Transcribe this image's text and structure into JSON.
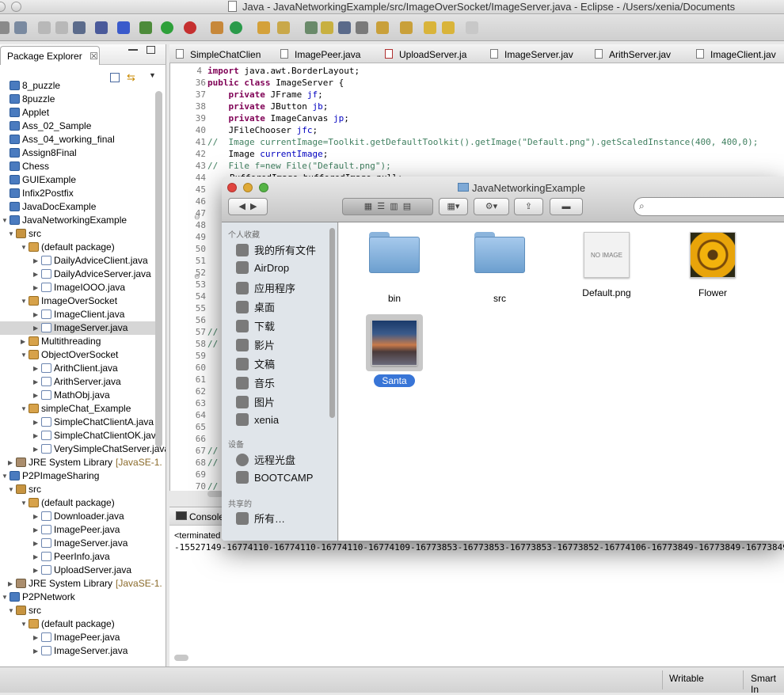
{
  "window": {
    "title": "Java - JavaNetworkingExample/src/ImageOverSocket/ImageServer.java - Eclipse - /Users/xenia/Documents"
  },
  "package_explorer": {
    "tab_label": "Package Explorer",
    "rows": [
      "8_puzzle",
      "8puzzle",
      "Applet",
      "Ass_02_Sample",
      "Ass_04_working_final",
      "Assign8Final",
      "Chess",
      "GUIExample",
      "Infix2Postfix",
      "JavaDocExample",
      "JavaNetworkingExample",
      "src",
      "(default package)",
      "DailyAdviceClient.java",
      "DailyAdviceServer.java",
      "ImageIOOO.java",
      "ImageOverSocket",
      "ImageClient.java",
      "ImageServer.java",
      "Multithreading",
      "ObjectOverSocket",
      "ArithClient.java",
      "ArithServer.java",
      "MathObj.java",
      "simpleChat_Example",
      "SimpleChatClientA.java",
      "SimpleChatClientOK.java",
      "VerySimpleChatServer.java",
      "JRE System Library",
      "P2PImageSharing",
      "src",
      "(default package)",
      "Downloader.java",
      "ImagePeer.java",
      "ImageServer.java",
      "PeerInfo.java",
      "UploadServer.java",
      "JRE System Library",
      "P2PNetwork",
      "src",
      "(default package)",
      "ImagePeer.java",
      "ImageServer.java"
    ],
    "jre_suffix": "[JavaSE-1."
  },
  "editor": {
    "tabs": [
      "SimpleChatClien",
      "ImagePeer.java",
      "UploadServer.ja",
      "ImageServer.jav",
      "ArithServer.jav",
      "ImageClient.jav"
    ],
    "line_numbers": [
      "4",
      "36",
      "37",
      "38",
      "39",
      "40",
      "41",
      "42",
      "43",
      "44",
      "45",
      "46",
      "47",
      "48",
      "49",
      "50",
      "51",
      "52",
      "53",
      "54",
      "55",
      "56",
      "57",
      "58",
      "59",
      "60",
      "61",
      "62",
      "63",
      "64",
      "65",
      "66",
      "67",
      "68",
      "69",
      "70"
    ],
    "code": {
      "l4": "import java.awt.BorderLayout;",
      "l36_kw": "public class",
      "l36_rest": " ImageServer {",
      "l37_kw": "private",
      "l37_type": " JFrame ",
      "l37_f": "jf",
      "l37_e": ";",
      "l38_kw": "private",
      "l38_type": " JButton ",
      "l38_f": "jb",
      "l38_e": ";",
      "l39_kw": "private",
      "l39_type": " ImageCanvas ",
      "l39_f": "jp",
      "l39_e": ";",
      "l40_type": "JFileChooser ",
      "l40_f": "jfc",
      "l40_e": ";",
      "l41": "//  Image currentImage=Toolkit.getDefaultToolkit().getImage(\"Default.png\").getScaledInstance(400, 400,0);",
      "l42_type": "Image ",
      "l42_f": "currentImage",
      "l42_e": ";",
      "l43": "//  File f=new File(\"Default.png\");",
      "l44": "BufferedImage bufferedImage=null;"
    }
  },
  "console": {
    "tab_label": "Console",
    "terminated": "<terminated",
    "output": "-15527149-16774110-16774110-16774110-16774109-16773853-16773853-16773853-16773852-16774106-16773849-16773849-16773849-1"
  },
  "statusbar": {
    "writable": "Writable",
    "insert_mode": "Smart In"
  },
  "finder": {
    "title": "JavaNetworkingExample",
    "sidebar": {
      "section_personal": "个人收藏",
      "personal": [
        "我的所有文件",
        "AirDrop",
        "应用程序",
        "桌面",
        "下载",
        "影片",
        "文稿",
        "音乐",
        "图片",
        "xenia"
      ],
      "section_devices": "设备",
      "devices": [
        "远程光盘",
        "BOOTCAMP"
      ],
      "section_shared": "共享的",
      "shared": [
        "所有…"
      ]
    },
    "items": [
      {
        "name": "bin",
        "kind": "folder"
      },
      {
        "name": "src",
        "kind": "folder"
      },
      {
        "name": "Default.png",
        "kind": "image",
        "placeholder": "NO IMAGE"
      },
      {
        "name": "Flower",
        "kind": "image"
      },
      {
        "name": "Santa",
        "kind": "image",
        "selected": true
      }
    ]
  },
  "colors": {
    "selection": "#3875d7",
    "keyword": "#7f0055",
    "field": "#0000c0",
    "comment": "#3f7f5f"
  }
}
